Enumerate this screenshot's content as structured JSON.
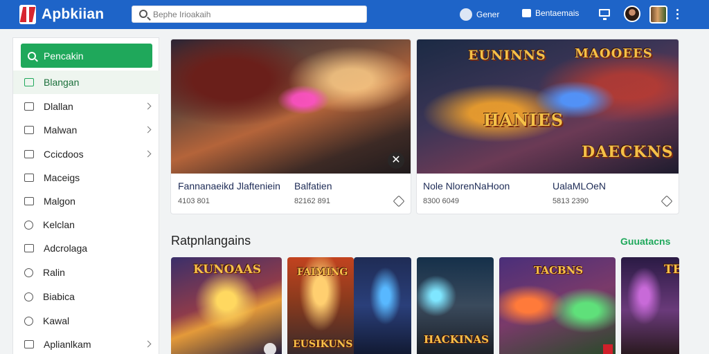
{
  "topbar": {
    "brand": "Apbkiian",
    "search_placeholder": "Bephe Irioakaih",
    "items": [
      {
        "label": "Gener",
        "icon": "gamepad-icon"
      },
      {
        "label": "Bentaemais",
        "icon": "message-icon"
      }
    ],
    "colors": {
      "bar": "#1e64c8",
      "accent": "#1fa85b"
    }
  },
  "sidebar": {
    "primary": {
      "label": "Pencakin",
      "icon": "search-icon"
    },
    "items": [
      {
        "label": "Blangan",
        "icon": "home-icon",
        "active": true,
        "chevron": false
      },
      {
        "label": "Dlallan",
        "icon": "calendar-icon",
        "chevron": true
      },
      {
        "label": "Malwan",
        "icon": "link-icon",
        "chevron": true
      },
      {
        "label": "Ccicdoos",
        "icon": "folder-icon",
        "chevron": true
      },
      {
        "label": "Maceigs",
        "icon": "image-icon",
        "chevron": false
      },
      {
        "label": "Malgon",
        "icon": "mail-icon",
        "chevron": false
      },
      {
        "label": "Kelclan",
        "icon": "face-icon",
        "chevron": false
      },
      {
        "label": "Adcrolaga",
        "icon": "document-icon",
        "chevron": false
      },
      {
        "label": "Ralin",
        "icon": "clock-icon",
        "chevron": false
      },
      {
        "label": "Biabica",
        "icon": "timer-icon",
        "chevron": false
      },
      {
        "label": "Kawal",
        "icon": "dollar-icon",
        "chevron": false
      },
      {
        "label": "Aplianlkam",
        "icon": "share-icon",
        "chevron": true
      }
    ]
  },
  "featured": [
    {
      "name": "Fannanaeikd Jlafteniein",
      "tag": "Balfatien",
      "meta1": "4103 801",
      "meta2": "82162 891",
      "art_text": []
    },
    {
      "name": "Nole NlorenNaHoon",
      "tag": "UalaMLOeN",
      "meta1": "8300 6049",
      "meta2": "5813 2390",
      "art_text": [
        "EUNINNS",
        "MAOOEES",
        "HANIES",
        "DAECKNS"
      ]
    }
  ],
  "section": {
    "title": "Ratpnlangains",
    "link": "Guuatacns"
  },
  "tiles": [
    {
      "art_text": "KUNOAAS"
    },
    {
      "art_text": "FAIMING",
      "bottom_text": "EUSIKUNS"
    },
    {
      "art_text": ""
    },
    {
      "art_text": "HACKINAS"
    },
    {
      "art_text": "TACBNS"
    },
    {
      "art_text": "TE"
    }
  ]
}
